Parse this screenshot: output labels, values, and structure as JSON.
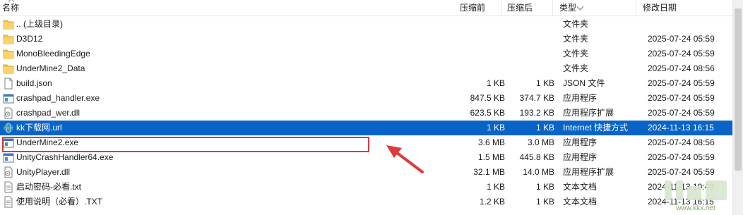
{
  "columns": {
    "name": "名称",
    "compressed": "压缩前",
    "uncompressed": "压缩后",
    "type": "类型",
    "modified": "修改日期"
  },
  "files": [
    {
      "name": ".. (上级目录)",
      "icon": "folder-icon",
      "size_before": "",
      "size_after": "",
      "type": "文件夹",
      "date": ""
    },
    {
      "name": "D3D12",
      "icon": "folder-icon",
      "size_before": "",
      "size_after": "",
      "type": "文件夹",
      "date": "2025-07-24 05:59"
    },
    {
      "name": "MonoBleedingEdge",
      "icon": "folder-icon",
      "size_before": "",
      "size_after": "",
      "type": "文件夹",
      "date": "2025-07-24 05:59"
    },
    {
      "name": "UnderMine2_Data",
      "icon": "folder-icon",
      "size_before": "",
      "size_after": "",
      "type": "文件夹",
      "date": "2025-07-24 08:56"
    },
    {
      "name": "build.json",
      "icon": "document-icon",
      "size_before": "1 KB",
      "size_after": "1 KB",
      "type": "JSON 文件",
      "date": "2025-07-24 05:59"
    },
    {
      "name": "crashpad_handler.exe",
      "icon": "application-icon",
      "size_before": "847.5 KB",
      "size_after": "374.7 KB",
      "type": "应用程序",
      "date": "2025-07-24 05:59"
    },
    {
      "name": "crashpad_wer.dll",
      "icon": "dll-icon",
      "size_before": "623.5 KB",
      "size_after": "193.2 KB",
      "type": "应用程序扩展",
      "date": "2025-07-24 05:59"
    },
    {
      "name": "kk下载网.url",
      "icon": "globe-icon",
      "size_before": "1 KB",
      "size_after": "1 KB",
      "type": "Internet 快捷方式",
      "date": "2024-11-13 16:15",
      "selected": true
    },
    {
      "name": "UnderMine2.exe",
      "icon": "application-icon",
      "size_before": "3.6 MB",
      "size_after": "3.0 MB",
      "type": "应用程序",
      "date": "2025-07-24 08:56",
      "highlighted": true
    },
    {
      "name": "UnityCrashHandler64.exe",
      "icon": "application-icon",
      "size_before": "1.5 MB",
      "size_after": "445.8 KB",
      "type": "应用程序",
      "date": "2025-07-24 05:59"
    },
    {
      "name": "UnityPlayer.dll",
      "icon": "dll-icon",
      "size_before": "32.1 MB",
      "size_after": "14.0 MB",
      "type": "应用程序扩展",
      "date": "2025-07-24 05:59"
    },
    {
      "name": "启动密码-必看.txt",
      "icon": "text-file-icon",
      "size_before": "1 KB",
      "size_after": "1 KB",
      "type": "文本文档",
      "date": "2024-11-13 10:40"
    },
    {
      "name": "使用说明（必看）.TXT",
      "icon": "text-file-icon",
      "size_before": "1.2 KB",
      "size_after": "1 KB",
      "type": "文本文档",
      "date": "2024-11-13 16:15"
    }
  ],
  "colors": {
    "selection": "#0a64c8",
    "highlight_box": "#e0393b",
    "folder": "#f6c451",
    "annotation_arrow": "#e0393b"
  },
  "watermark": {
    "text": "www.kkx.net"
  }
}
